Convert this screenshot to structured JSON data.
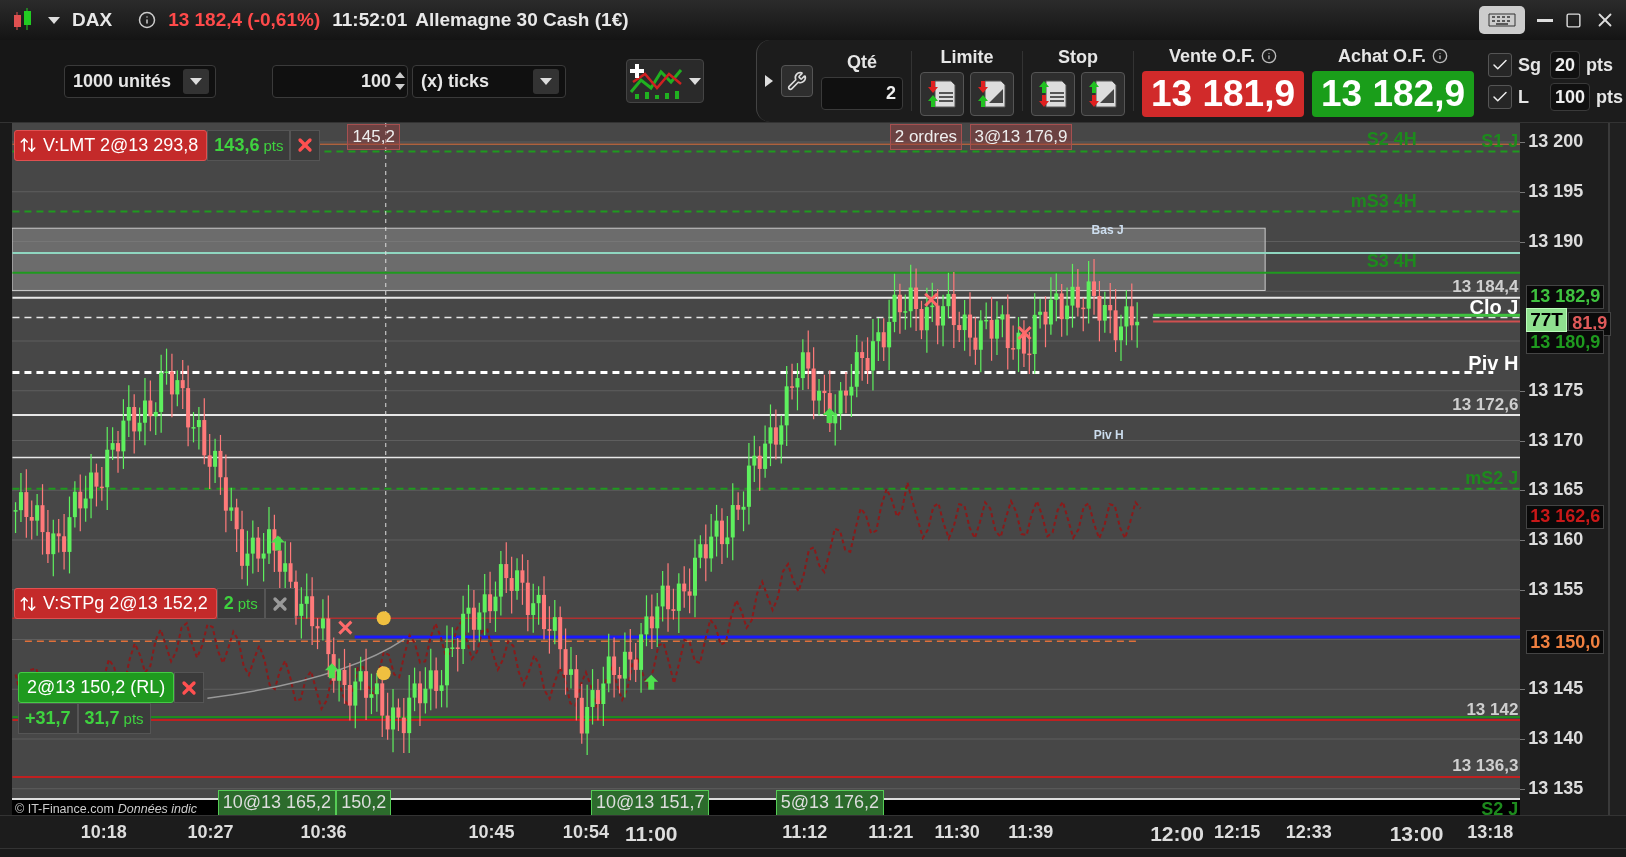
{
  "header": {
    "symbol": "DAX",
    "quote": "13 182,4 (-0,61%)",
    "time": "11:52:01",
    "instrument": "Allemagne 30 Cash (1€)"
  },
  "toolbar": {
    "units": "1000 unités",
    "ticks_value": "100",
    "ticks_mode": "(x) ticks",
    "qty_label": "Qté",
    "qty_value": "2",
    "limit_label": "Limite",
    "stop_label": "Stop",
    "sell_label": "Vente O.F.",
    "buy_label": "Achat O.F.",
    "sell_price": "13 181,9",
    "buy_price": "13 182,9",
    "options": [
      {
        "label": "Sg",
        "checked": true,
        "value": "20",
        "unit": "pts"
      },
      {
        "label": "L",
        "checked": true,
        "value": "100",
        "unit": "pts"
      }
    ]
  },
  "chart": {
    "orders": [
      {
        "label": "V:LMT 2@13 293,8",
        "distance": "143,6",
        "unit": "pts",
        "cancel_active": true
      },
      {
        "label": "V:STPg 2@13 152,2",
        "distance": "2",
        "unit": "pts",
        "cancel_active": false
      }
    ],
    "position": {
      "label": "2@13 150,2 (RL)",
      "pnl": "+31,7",
      "distance": "31,7",
      "unit": "pts"
    },
    "top_tags": [
      "145,2",
      "2 ordres",
      "3@13 176,9"
    ],
    "executions": [
      "10@13 165,2",
      "150,2",
      "10@13 151,7",
      "5@13 176,2"
    ],
    "levels": [
      {
        "label": "S2 4H",
        "kind": "pivot"
      },
      {
        "label": "S1 J",
        "kind": "pivot"
      },
      {
        "label": "mS3 4H",
        "kind": "pivot"
      },
      {
        "label": "S3 4H",
        "kind": "pivot"
      },
      {
        "label": "Bas J",
        "kind": "note"
      },
      {
        "label": "13 184,4",
        "kind": "value"
      },
      {
        "label": "Clo J",
        "kind": "marker"
      },
      {
        "label": "Piv H",
        "kind": "marker"
      },
      {
        "label": "13 172,6",
        "kind": "value"
      },
      {
        "label": "Piv H",
        "kind": "note"
      },
      {
        "label": "mS2 J",
        "kind": "pivot"
      },
      {
        "label": "13 142",
        "kind": "value"
      },
      {
        "label": "13 136,3",
        "kind": "value"
      },
      {
        "label": "S2 J",
        "kind": "pivot"
      }
    ],
    "copyright": "© IT-Finance.com",
    "disclaimer": "Données indic",
    "price_ticks": [
      "13 200",
      "13 195",
      "13 190",
      "13 175",
      "13 170",
      "13 165",
      "13 160",
      "13 155",
      "13 145",
      "13 140",
      "13 135"
    ],
    "price_tags": [
      {
        "label": "13 182,9",
        "color": "#3fc23f"
      },
      {
        "label": "81,9",
        "color": "#e05a5a"
      },
      {
        "label": "13 180,9",
        "color": "#1f9a1f"
      },
      {
        "label": "13 162,6",
        "color": "#c81818"
      },
      {
        "label": "13 150,0",
        "color": "#f08040"
      }
    ],
    "tick_counter": "77T",
    "time_ticks": [
      {
        "label": "10:18",
        "major": false
      },
      {
        "label": "10:27",
        "major": false
      },
      {
        "label": "10:36",
        "major": false
      },
      {
        "label": "10:45",
        "major": false
      },
      {
        "label": "10:54",
        "major": false
      },
      {
        "label": "11:00",
        "major": true
      },
      {
        "label": "11:12",
        "major": false
      },
      {
        "label": "11:21",
        "major": false
      },
      {
        "label": "11:30",
        "major": false
      },
      {
        "label": "11:39",
        "major": false
      },
      {
        "label": "12:00",
        "major": true
      },
      {
        "label": "12:15",
        "major": false
      },
      {
        "label": "12:33",
        "major": false
      },
      {
        "label": "13:00",
        "major": true
      },
      {
        "label": "13:18",
        "major": false
      }
    ]
  }
}
